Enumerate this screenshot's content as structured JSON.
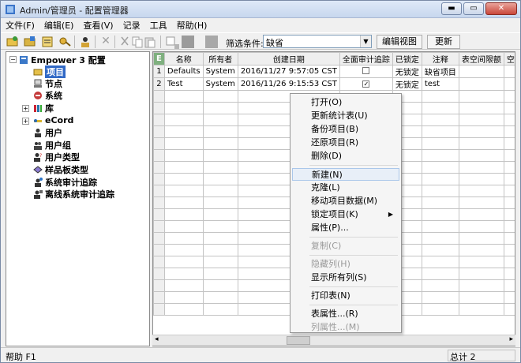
{
  "window": {
    "title": "Admin/管理员 - 配置管理器",
    "controls": {
      "minimize": "▬",
      "maximize": "▭",
      "close": "✕"
    }
  },
  "menubar": [
    "文件(F)",
    "编辑(E)",
    "查看(V)",
    "记录",
    "工具",
    "帮助(H)"
  ],
  "toolbar": {
    "filter_label": "筛选条件:",
    "filter_value": "缺省",
    "edit_view_button": "编辑视图",
    "update_button": "更新"
  },
  "tree": {
    "root": "Empower 3 配置",
    "items": [
      {
        "label": "项目",
        "icon": "project-folder-icon",
        "selected": true
      },
      {
        "label": "节点",
        "icon": "node-computer-icon"
      },
      {
        "label": "系统",
        "icon": "system-icon"
      },
      {
        "label": "库",
        "icon": "library-icon",
        "expandable": true
      },
      {
        "label": "eCord",
        "icon": "ecord-icon",
        "expandable": true
      },
      {
        "label": "用户",
        "icon": "user-icon"
      },
      {
        "label": "用户组",
        "icon": "user-group-icon"
      },
      {
        "label": "用户类型",
        "icon": "user-type-icon"
      },
      {
        "label": "样品板类型",
        "icon": "plate-type-icon"
      },
      {
        "label": "系统审计追踪",
        "icon": "system-audit-icon"
      },
      {
        "label": "离线系统审计追踪",
        "icon": "offline-audit-icon"
      }
    ]
  },
  "grid": {
    "columns": [
      "名称",
      "所有者",
      "创建日期",
      "全面审计追踪",
      "已锁定",
      "注释",
      "表空间限额",
      "空闲表空"
    ],
    "rows": [
      {
        "num": "1",
        "name": "Defaults",
        "owner": "System",
        "created": "2016/11/27 9:57:05 CST",
        "audit": false,
        "locked": "无锁定",
        "comment": "缺省项目"
      },
      {
        "num": "2",
        "name": "Test",
        "owner": "System",
        "created": "2016/11/26 9:15:53 CST",
        "audit": true,
        "locked": "无锁定",
        "comment": "test"
      }
    ]
  },
  "context_menu": [
    {
      "label": "打开(O)"
    },
    {
      "label": "更新统计表(U)"
    },
    {
      "label": "备份项目(B)"
    },
    {
      "label": "还原项目(R)"
    },
    {
      "label": "删除(D)"
    },
    {
      "label": "新建(N)",
      "hover": true
    },
    {
      "label": "克隆(L)"
    },
    {
      "label": "移动项目数据(M)"
    },
    {
      "label": "锁定项目(K)",
      "submenu": true
    },
    {
      "label": "属性(P)..."
    },
    {
      "label": "复制(C)",
      "disabled": true
    },
    {
      "label": "隐藏列(H)",
      "disabled": true
    },
    {
      "label": "显示所有列(S)"
    },
    {
      "label": "打印表(N)"
    },
    {
      "label": "表属性...(R)"
    },
    {
      "label": "列属性...(M)",
      "disabled": true
    }
  ],
  "status": {
    "left": "帮助 F1",
    "right": "总计 2"
  }
}
